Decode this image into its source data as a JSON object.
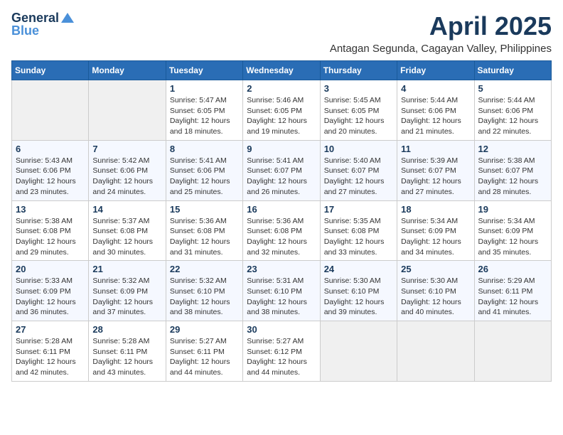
{
  "header": {
    "logo_line1": "General",
    "logo_line2": "Blue",
    "month": "April 2025",
    "location": "Antagan Segunda, Cagayan Valley, Philippines"
  },
  "weekdays": [
    "Sunday",
    "Monday",
    "Tuesday",
    "Wednesday",
    "Thursday",
    "Friday",
    "Saturday"
  ],
  "weeks": [
    [
      {
        "day": "",
        "info": ""
      },
      {
        "day": "",
        "info": ""
      },
      {
        "day": "1",
        "sunrise": "Sunrise: 5:47 AM",
        "sunset": "Sunset: 6:05 PM",
        "daylight": "Daylight: 12 hours and 18 minutes."
      },
      {
        "day": "2",
        "sunrise": "Sunrise: 5:46 AM",
        "sunset": "Sunset: 6:05 PM",
        "daylight": "Daylight: 12 hours and 19 minutes."
      },
      {
        "day": "3",
        "sunrise": "Sunrise: 5:45 AM",
        "sunset": "Sunset: 6:05 PM",
        "daylight": "Daylight: 12 hours and 20 minutes."
      },
      {
        "day": "4",
        "sunrise": "Sunrise: 5:44 AM",
        "sunset": "Sunset: 6:06 PM",
        "daylight": "Daylight: 12 hours and 21 minutes."
      },
      {
        "day": "5",
        "sunrise": "Sunrise: 5:44 AM",
        "sunset": "Sunset: 6:06 PM",
        "daylight": "Daylight: 12 hours and 22 minutes."
      }
    ],
    [
      {
        "day": "6",
        "sunrise": "Sunrise: 5:43 AM",
        "sunset": "Sunset: 6:06 PM",
        "daylight": "Daylight: 12 hours and 23 minutes."
      },
      {
        "day": "7",
        "sunrise": "Sunrise: 5:42 AM",
        "sunset": "Sunset: 6:06 PM",
        "daylight": "Daylight: 12 hours and 24 minutes."
      },
      {
        "day": "8",
        "sunrise": "Sunrise: 5:41 AM",
        "sunset": "Sunset: 6:06 PM",
        "daylight": "Daylight: 12 hours and 25 minutes."
      },
      {
        "day": "9",
        "sunrise": "Sunrise: 5:41 AM",
        "sunset": "Sunset: 6:07 PM",
        "daylight": "Daylight: 12 hours and 26 minutes."
      },
      {
        "day": "10",
        "sunrise": "Sunrise: 5:40 AM",
        "sunset": "Sunset: 6:07 PM",
        "daylight": "Daylight: 12 hours and 27 minutes."
      },
      {
        "day": "11",
        "sunrise": "Sunrise: 5:39 AM",
        "sunset": "Sunset: 6:07 PM",
        "daylight": "Daylight: 12 hours and 27 minutes."
      },
      {
        "day": "12",
        "sunrise": "Sunrise: 5:38 AM",
        "sunset": "Sunset: 6:07 PM",
        "daylight": "Daylight: 12 hours and 28 minutes."
      }
    ],
    [
      {
        "day": "13",
        "sunrise": "Sunrise: 5:38 AM",
        "sunset": "Sunset: 6:08 PM",
        "daylight": "Daylight: 12 hours and 29 minutes."
      },
      {
        "day": "14",
        "sunrise": "Sunrise: 5:37 AM",
        "sunset": "Sunset: 6:08 PM",
        "daylight": "Daylight: 12 hours and 30 minutes."
      },
      {
        "day": "15",
        "sunrise": "Sunrise: 5:36 AM",
        "sunset": "Sunset: 6:08 PM",
        "daylight": "Daylight: 12 hours and 31 minutes."
      },
      {
        "day": "16",
        "sunrise": "Sunrise: 5:36 AM",
        "sunset": "Sunset: 6:08 PM",
        "daylight": "Daylight: 12 hours and 32 minutes."
      },
      {
        "day": "17",
        "sunrise": "Sunrise: 5:35 AM",
        "sunset": "Sunset: 6:08 PM",
        "daylight": "Daylight: 12 hours and 33 minutes."
      },
      {
        "day": "18",
        "sunrise": "Sunrise: 5:34 AM",
        "sunset": "Sunset: 6:09 PM",
        "daylight": "Daylight: 12 hours and 34 minutes."
      },
      {
        "day": "19",
        "sunrise": "Sunrise: 5:34 AM",
        "sunset": "Sunset: 6:09 PM",
        "daylight": "Daylight: 12 hours and 35 minutes."
      }
    ],
    [
      {
        "day": "20",
        "sunrise": "Sunrise: 5:33 AM",
        "sunset": "Sunset: 6:09 PM",
        "daylight": "Daylight: 12 hours and 36 minutes."
      },
      {
        "day": "21",
        "sunrise": "Sunrise: 5:32 AM",
        "sunset": "Sunset: 6:09 PM",
        "daylight": "Daylight: 12 hours and 37 minutes."
      },
      {
        "day": "22",
        "sunrise": "Sunrise: 5:32 AM",
        "sunset": "Sunset: 6:10 PM",
        "daylight": "Daylight: 12 hours and 38 minutes."
      },
      {
        "day": "23",
        "sunrise": "Sunrise: 5:31 AM",
        "sunset": "Sunset: 6:10 PM",
        "daylight": "Daylight: 12 hours and 38 minutes."
      },
      {
        "day": "24",
        "sunrise": "Sunrise: 5:30 AM",
        "sunset": "Sunset: 6:10 PM",
        "daylight": "Daylight: 12 hours and 39 minutes."
      },
      {
        "day": "25",
        "sunrise": "Sunrise: 5:30 AM",
        "sunset": "Sunset: 6:10 PM",
        "daylight": "Daylight: 12 hours and 40 minutes."
      },
      {
        "day": "26",
        "sunrise": "Sunrise: 5:29 AM",
        "sunset": "Sunset: 6:11 PM",
        "daylight": "Daylight: 12 hours and 41 minutes."
      }
    ],
    [
      {
        "day": "27",
        "sunrise": "Sunrise: 5:28 AM",
        "sunset": "Sunset: 6:11 PM",
        "daylight": "Daylight: 12 hours and 42 minutes."
      },
      {
        "day": "28",
        "sunrise": "Sunrise: 5:28 AM",
        "sunset": "Sunset: 6:11 PM",
        "daylight": "Daylight: 12 hours and 43 minutes."
      },
      {
        "day": "29",
        "sunrise": "Sunrise: 5:27 AM",
        "sunset": "Sunset: 6:11 PM",
        "daylight": "Daylight: 12 hours and 44 minutes."
      },
      {
        "day": "30",
        "sunrise": "Sunrise: 5:27 AM",
        "sunset": "Sunset: 6:12 PM",
        "daylight": "Daylight: 12 hours and 44 minutes."
      },
      {
        "day": "",
        "info": ""
      },
      {
        "day": "",
        "info": ""
      },
      {
        "day": "",
        "info": ""
      }
    ]
  ]
}
